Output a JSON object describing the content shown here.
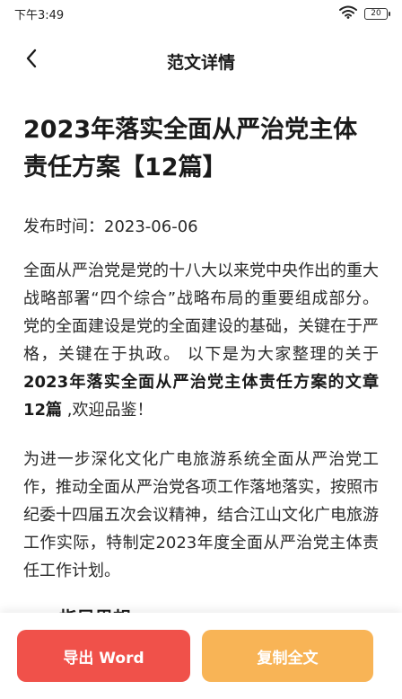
{
  "status_bar": {
    "time": "下午3:49",
    "battery_text": "20",
    "wifi_icon": "wifi-icon"
  },
  "header": {
    "title": "范文详情",
    "back_icon": "chevron-left-icon"
  },
  "article": {
    "title": "2023年落实全面从严治党主体责任方案【12篇】",
    "publish_label": "发布时间：",
    "publish_date": "2023-06-06",
    "intro_part1": "全面从严治党是党的十八大以来党中央作出的重大战略部署“四个综合”战略布局的重要组成部分。党的全面建设是党的全面建设的基础，关键在于严格，关键在于执政。 以下是为大家整理的关于 ",
    "intro_bold": "2023年落实全面从严治党主体责任方案的文章12篇",
    "intro_part2": " ,欢迎品鉴！",
    "paragraph2": "为进一步深化文化广电旅游系统全面从严治党工作，推动全面从严治党各项工作落地落实，按照市纪委十四届五次会议精神，结合江山文化广电旅游工作实际，特制定2023年度全面从严治党主体责任工作计划。",
    "section1_heading": "一、指导思想"
  },
  "actions": {
    "export_label": "导出 Word",
    "copy_label": "复制全文"
  },
  "colors": {
    "export_button": "#f0514a",
    "copy_button": "#f8b456"
  }
}
